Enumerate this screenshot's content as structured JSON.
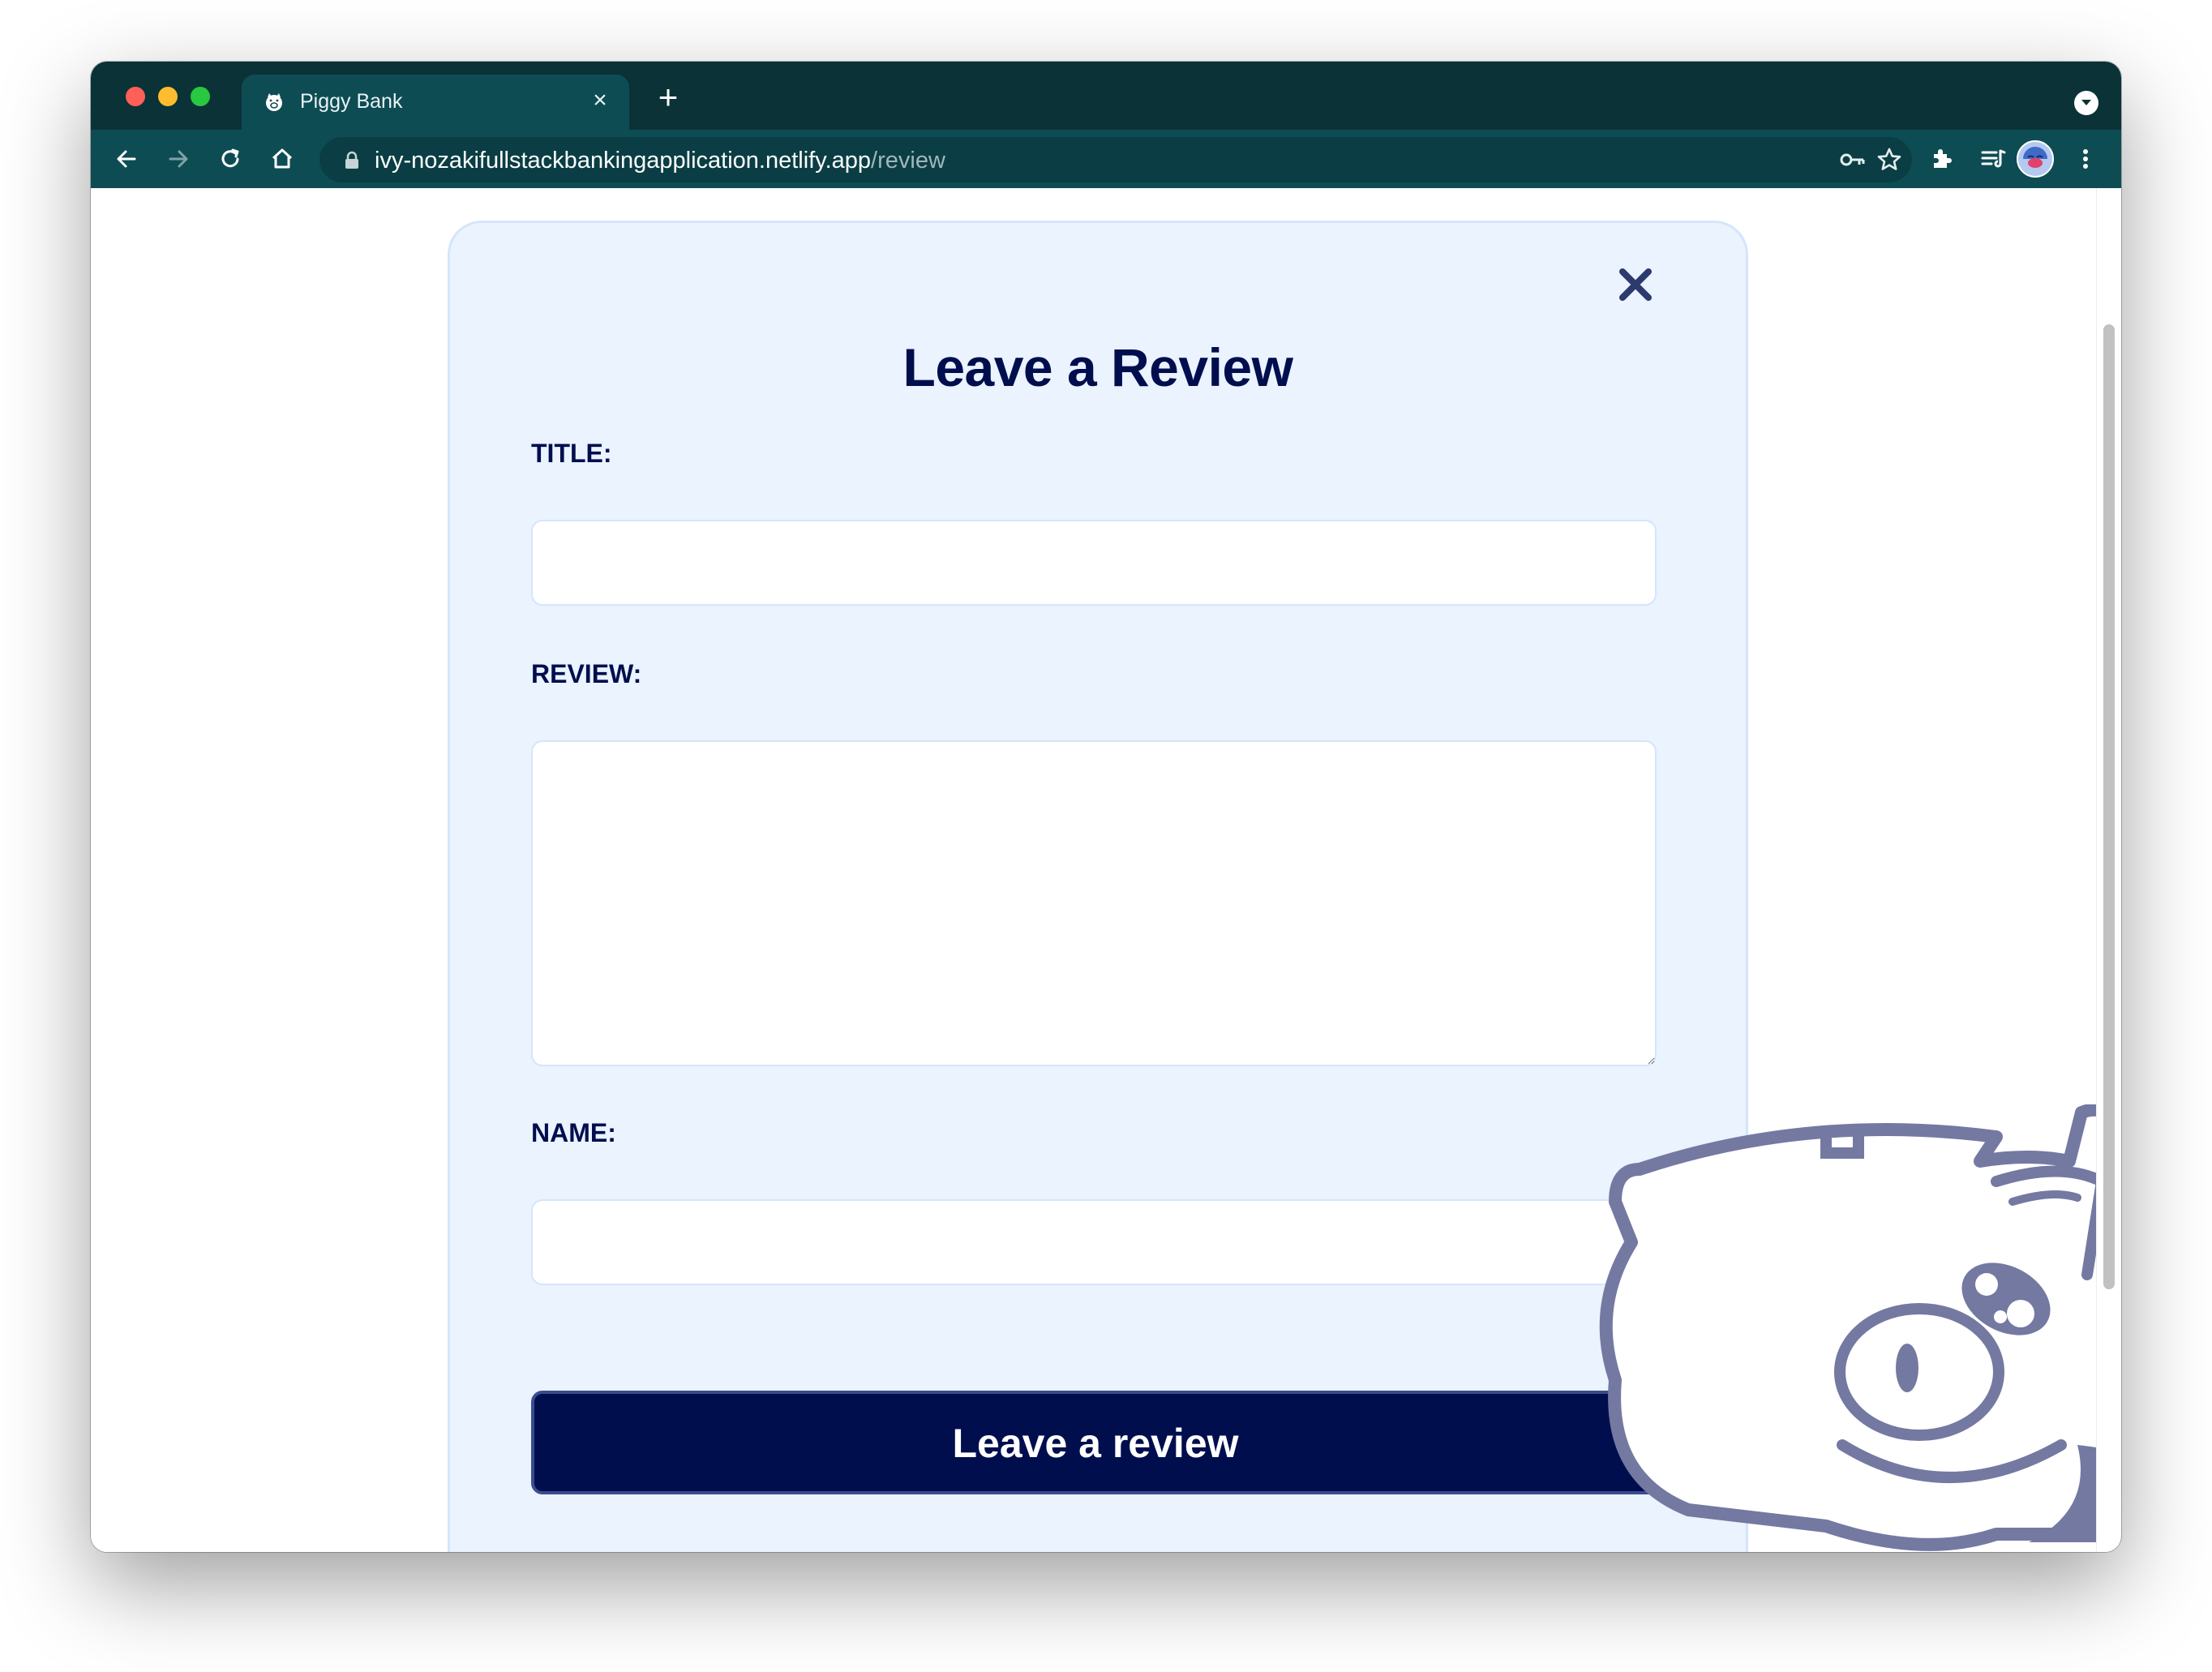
{
  "browser": {
    "tab": {
      "title": "Piggy Bank",
      "close_glyph": "×",
      "favicon": "piggy-favicon-icon"
    },
    "new_tab_glyph": "+",
    "address": {
      "host": "ivy-nozakifullstackbankingapplication.netlify.app",
      "path": "/review"
    },
    "toolbar_icons": [
      "back-icon",
      "forward-icon",
      "reload-icon",
      "home-icon",
      "lock-icon",
      "key-icon",
      "star-icon",
      "extensions-icon",
      "reading-list-icon",
      "profile-avatar",
      "more-menu-icon"
    ]
  },
  "review_form": {
    "heading": "Leave a Review",
    "title_label": "TITLE:",
    "title_value": "",
    "review_label": "REVIEW:",
    "review_value": "",
    "name_label": "NAME:",
    "name_value": "",
    "submit_label": "Leave a review",
    "close_icon": "close-icon"
  },
  "colors": {
    "chrome_tabstrip": "#0a3237",
    "chrome_toolbar": "#0e4c54",
    "card_bg": "#eaf3fe",
    "navy": "#000e4e",
    "pig_outline": "#7479a2"
  }
}
